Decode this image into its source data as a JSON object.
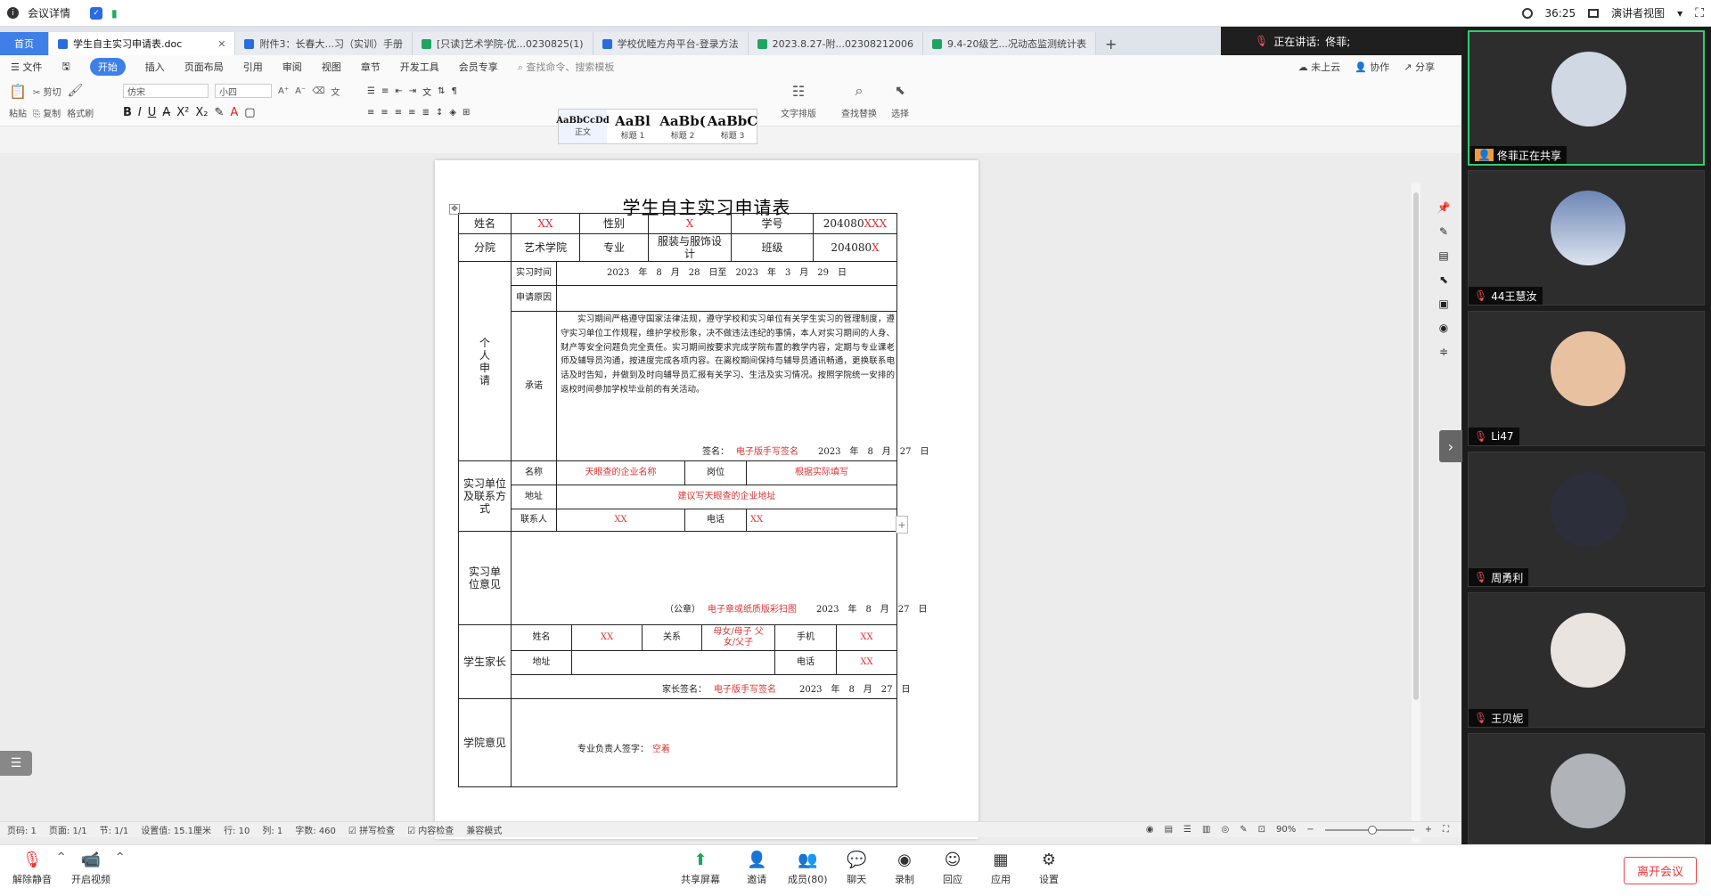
{
  "topbar": {
    "meeting_info": "会议详情",
    "time": "36:25",
    "view_mode": "演讲者视图"
  },
  "tabs": [
    {
      "label": "首页"
    },
    {
      "label": "学生自主实习申请表.doc"
    },
    {
      "label": "附件3：长春大...习（实训）手册"
    },
    {
      "label": "[只读]艺术学院-优...0230825(1)"
    },
    {
      "label": "学校优睦方舟平台-登录方法"
    },
    {
      "label": "2023.8.27-附...02308212006"
    },
    {
      "label": "9.4-20级艺...况动态监测统计表"
    }
  ],
  "speaking": {
    "label": "正在讲话:",
    "name": "佟菲;"
  },
  "menu": {
    "file": "文件",
    "start": "开始",
    "insert": "插入",
    "layout": "页面布局",
    "ref": "引用",
    "review": "审阅",
    "view": "视图",
    "chapter": "章节",
    "dev": "开发工具",
    "member": "会员专享",
    "search": "查找命令、搜索模板",
    "cloud": "未上云",
    "collab": "协作",
    "share": "分享"
  },
  "ribbon": {
    "paste": "粘贴",
    "cut": "剪切",
    "copy": "复制",
    "format_painter": "格式刷",
    "font": "仿宋",
    "size": "小四",
    "styles": [
      {
        "sample": "AaBbCcDd",
        "name": "正文"
      },
      {
        "sample": "AaBl",
        "name": "标题 1"
      },
      {
        "sample": "AaBb(",
        "name": "标题 2"
      },
      {
        "sample": "AaBbC",
        "name": "标题 3"
      }
    ],
    "text_layout": "文字排版",
    "find_replace": "查找替换",
    "select": "选择"
  },
  "doc": {
    "title": "学生自主实习申请表",
    "name_label": "姓名",
    "name_val": "XX",
    "gender_label": "性别",
    "gender_val": "X",
    "id_label": "学号",
    "id_prefix": "204080",
    "id_suffix": "XXX",
    "college_label": "分院",
    "college_val": "艺术学院",
    "major_label": "专业",
    "major_val": "服装与服饰设计",
    "class_label": "班级",
    "class_prefix": "204080",
    "class_suffix": "X",
    "personal_label": "个人申请",
    "time_label": "实习时间",
    "time_val": "2023　年　8　月　28　日至　2023　年　3　月　29　日",
    "reason_label": "申请原因",
    "promise_label": "承诺",
    "promise_text": "实习期间严格遵守国家法律法规，遵守学校和实习单位有关学生实习的管理制度，遵守实习单位工作规程，维护学校形象，决不做违法违纪的事情，本人对实习期间的人身、财产等安全问题负完全责任。实习期间按要求完成学院布置的教学内容，定期与专业课老师及辅导员沟通，按进度完成各项内容。在离校期间保持与辅导员通讯畅通，更换联系电话及时告知，并做到及时向辅导员汇报有关学习、生活及实习情况。按照学院统一安排的返校时间参加学校毕业前的有关活动。",
    "sign_label": "签名：",
    "sign_val": "电子版手写签名",
    "sign_date": "2023　年　8　月　27　日",
    "unit_label": "实习单位及联系方式",
    "uname_label": "名称",
    "uname_val": "天眼查的企业名称",
    "post_label": "岗位",
    "post_val": "根据实际填写",
    "addr_label": "地址",
    "addr_val": "建议写天眼查的企业地址",
    "contact_label": "联系人",
    "contact_val": "XX",
    "phone_label": "电话",
    "phone_val": "XX",
    "opinion_label": "实习单位意见",
    "seal_label": "（公章）",
    "seal_val": "电子章或纸质版彩扫图",
    "seal_date": "2023　年　8　月　27　日",
    "parent_label": "学生家长",
    "pname_label": "姓名",
    "pname_val": "XX",
    "rel_label": "关系",
    "rel_val": "母女/母子 父女/父子",
    "mobile_label": "手机",
    "mobile_val": "XX",
    "paddr_label": "地址",
    "pphone_label": "电话",
    "pphone_val": "XX",
    "psign_label": "家长签名：",
    "psign_val": "电子版手写签名",
    "psign_date": "2023　年　8　月　27　日",
    "college_opinion": "学院意见",
    "major_sign_label": "专业负责人签字：",
    "major_sign_val": "空着"
  },
  "status": {
    "page_code": "页码: 1",
    "page": "页面: 1/1",
    "section": "节: 1/1",
    "setting": "设置值: 15.1厘米",
    "row": "行: 10",
    "col": "列: 1",
    "words": "字数: 460",
    "spell": "拼写检查",
    "content": "内容检查",
    "compat": "兼容模式",
    "zoom": "90%"
  },
  "participants": [
    {
      "name": "佟菲正在共享",
      "avatar": "#cfd8e3"
    },
    {
      "name": "44王慧汝",
      "avatar": "#6c86b5"
    },
    {
      "name": "Li47",
      "avatar": "#e8c2a0"
    },
    {
      "name": "周勇利",
      "avatar": "#2c2f3a"
    },
    {
      "name": "王贝妮",
      "avatar": "#e9e4e0"
    },
    {
      "name": "",
      "avatar": "#b0b3b8"
    }
  ],
  "bottombar": {
    "unmute": "解除静音",
    "video": "开启视频",
    "share": "共享屏幕",
    "invite": "邀请",
    "members": "成员(80)",
    "chat": "聊天",
    "record": "录制",
    "reply": "回应",
    "apps": "应用",
    "settings": "设置",
    "leave": "离开会议"
  }
}
